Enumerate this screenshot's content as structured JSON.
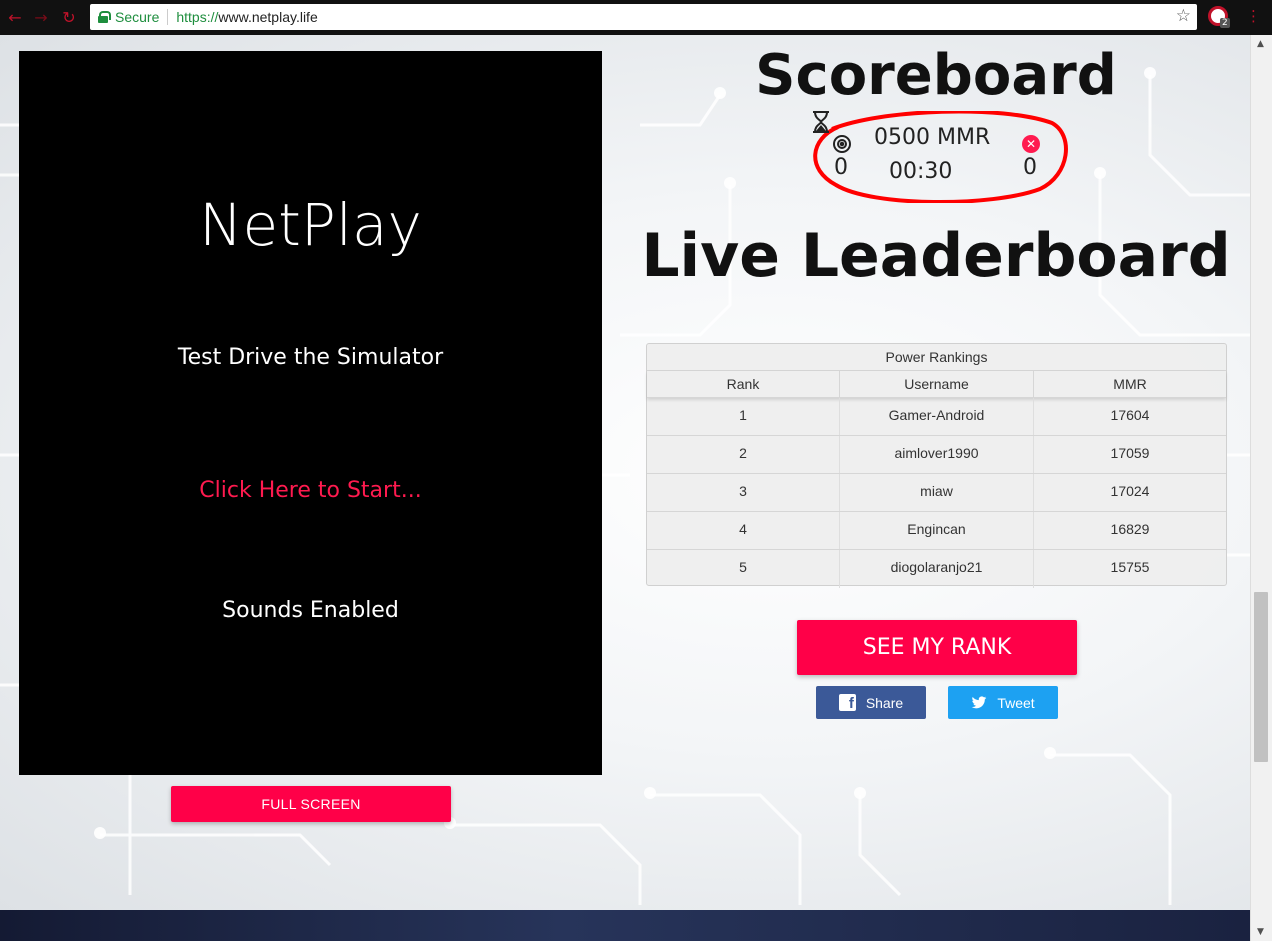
{
  "browser": {
    "secure_label": "Secure",
    "url_scheme": "https://",
    "url_host": "www.netplay.life",
    "extension_badge": "2"
  },
  "game": {
    "title": "NetPlay",
    "subtitle": "Test Drive the Simulator",
    "start_label": "Click Here to Start...",
    "sound_label": "Sounds Enabled",
    "fullscreen_label": "FULL SCREEN"
  },
  "scoreboard": {
    "title": "Scoreboard",
    "hits": "0",
    "misses": "0",
    "mmr": "0500 MMR",
    "timer": "00:30"
  },
  "leaderboard": {
    "title": "Live Leaderboard",
    "caption": "Power Rankings",
    "columns": [
      "Rank",
      "Username",
      "MMR"
    ],
    "rows": [
      {
        "rank": "1",
        "username": "Gamer-Android",
        "mmr": "17604"
      },
      {
        "rank": "2",
        "username": "aimlover1990",
        "mmr": "17059"
      },
      {
        "rank": "3",
        "username": "miaw",
        "mmr": "17024"
      },
      {
        "rank": "4",
        "username": "Engincan",
        "mmr": "16829"
      },
      {
        "rank": "5",
        "username": "diogolaranjo21",
        "mmr": "15755"
      }
    ]
  },
  "actions": {
    "see_rank_label": "SEE MY RANK",
    "share_label": "Share",
    "tweet_label": "Tweet"
  },
  "colors": {
    "accent": "#ff0048",
    "facebook": "#3b5998",
    "twitter": "#1da1f2",
    "annotation": "#ff0000"
  },
  "icons": {
    "hits": "target-icon",
    "misses": "miss-icon",
    "timer": "hourglass-icon"
  }
}
